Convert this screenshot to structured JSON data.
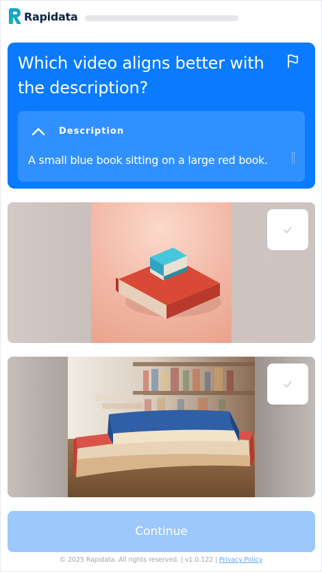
{
  "header": {
    "logo_text": "Rapidata",
    "progress_fraction": 0.0
  },
  "question": {
    "title": "Which video aligns better with the description?",
    "flag_icon": "flag-icon",
    "description_heading": "Description",
    "description_text": "A small blue book sitting on a large red book."
  },
  "options": [
    {
      "selected": false,
      "check_icon": "checkmark-icon"
    },
    {
      "selected": false,
      "check_icon": "checkmark-icon"
    }
  ],
  "continue_label": "Continue",
  "footer": {
    "copyright": "© 2025 Rapidata. All rights reserved.",
    "separator": "|",
    "version": "v1.0.122",
    "privacy_label": "Privacy Policy"
  },
  "colors": {
    "primary": "#0a7bff",
    "continue_disabled": "#9cc8fb",
    "logo_teal": "#14b8a6",
    "logo_navy": "#0b2344"
  }
}
